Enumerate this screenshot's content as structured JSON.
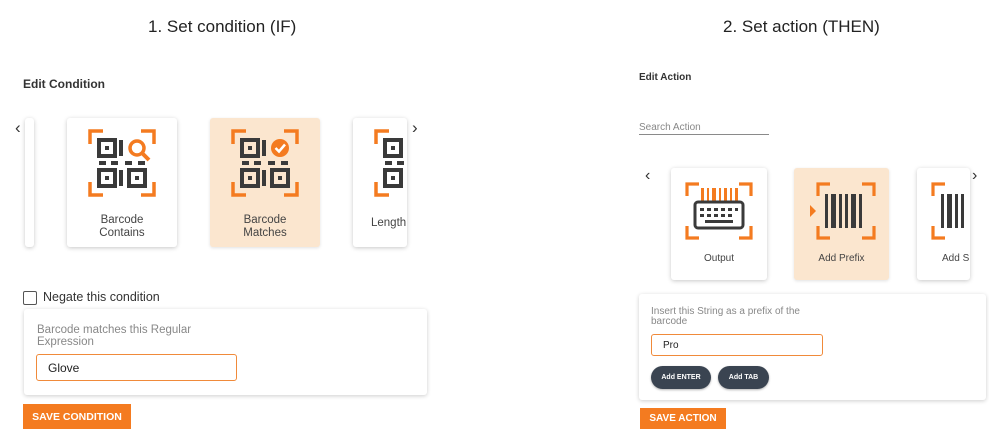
{
  "condition_section": {
    "step_title": "1.  Set condition (IF)",
    "heading": "Edit Condition",
    "cards": [
      {
        "label": "Barcode\nContains",
        "icon": "qr-search-icon",
        "selected": false
      },
      {
        "label": "Barcode\nMatches",
        "icon": "qr-check-icon",
        "selected": true
      },
      {
        "label": "Length",
        "icon": "qr-icon",
        "selected": false
      }
    ],
    "negate_label": "Negate this condition",
    "negate_checked": false,
    "field_label": "Barcode matches this Regular Expression",
    "field_value": "Glove",
    "save_label": "SAVE CONDITION"
  },
  "action_section": {
    "step_title": "2.  Set action (THEN)",
    "heading": "Edit Action",
    "search_placeholder": "Search Action",
    "cards": [
      {
        "label": "Output",
        "icon": "keyboard-barcode-icon",
        "selected": false
      },
      {
        "label": "Add Prefix",
        "icon": "prefix-barcode-icon",
        "selected": true
      },
      {
        "label": "Add S",
        "icon": "barcode-icon",
        "selected": false
      }
    ],
    "field_label": "Insert this String as a prefix of the barcode",
    "field_value": "Pro",
    "add_enter_label": "Add ENTER",
    "add_tab_label": "Add TAB",
    "save_label": "SAVE ACTION"
  },
  "colors": {
    "accent": "#f47b20",
    "selected_card": "#fbe6cf",
    "pill": "#3a4451"
  }
}
